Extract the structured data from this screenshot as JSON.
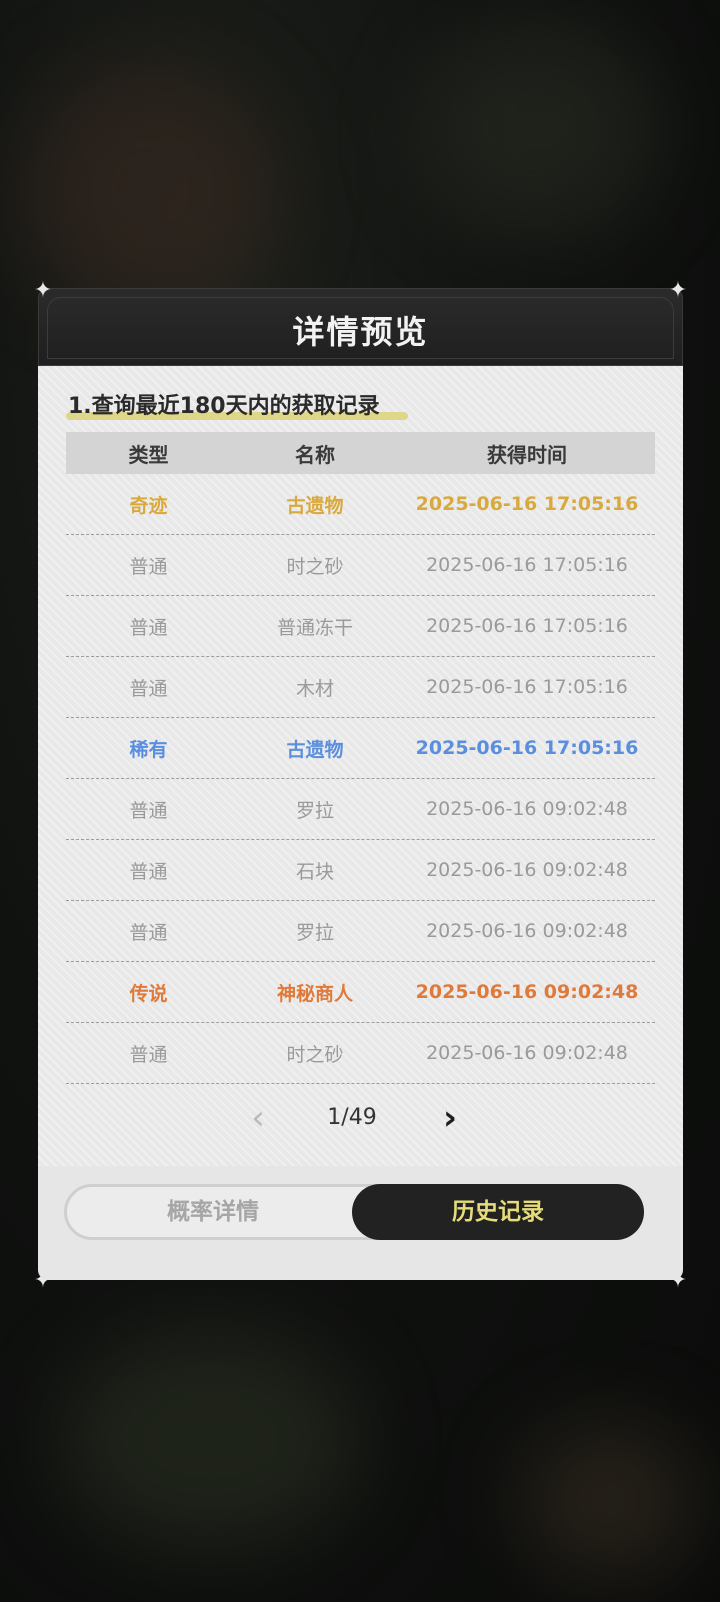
{
  "modal": {
    "title": "详情预览",
    "section_title": "1.查询最近180天内的获取记录",
    "table": {
      "headers": [
        "类型",
        "名称",
        "获得时间"
      ],
      "rows": [
        {
          "type": "奇迹",
          "name": "古遗物",
          "time": "2025-06-16 17:05:16",
          "tier": "wonder"
        },
        {
          "type": "普通",
          "name": "时之砂",
          "time": "2025-06-16 17:05:16",
          "tier": "normal"
        },
        {
          "type": "普通",
          "name": "普通冻干",
          "time": "2025-06-16 17:05:16",
          "tier": "normal"
        },
        {
          "type": "普通",
          "name": "木材",
          "time": "2025-06-16 17:05:16",
          "tier": "normal"
        },
        {
          "type": "稀有",
          "name": "古遗物",
          "time": "2025-06-16 17:05:16",
          "tier": "rare"
        },
        {
          "type": "普通",
          "name": "罗拉",
          "time": "2025-06-16 09:02:48",
          "tier": "normal"
        },
        {
          "type": "普通",
          "name": "石块",
          "time": "2025-06-16 09:02:48",
          "tier": "normal"
        },
        {
          "type": "普通",
          "name": "罗拉",
          "time": "2025-06-16 09:02:48",
          "tier": "normal"
        },
        {
          "type": "传说",
          "name": "神秘商人",
          "time": "2025-06-16 09:02:48",
          "tier": "legend"
        },
        {
          "type": "普通",
          "name": "时之砂",
          "time": "2025-06-16 09:02:48",
          "tier": "normal"
        }
      ]
    },
    "pagination": {
      "page": "1/49",
      "prev_icon": "chevron-left-icon",
      "next_icon": "chevron-right-icon"
    },
    "tabs": [
      {
        "label": "概率详情",
        "active": false
      },
      {
        "label": "历史记录",
        "active": true
      }
    ]
  },
  "colors": {
    "wonder": "#d9a93e",
    "rare": "#5b8fde",
    "legend": "#e07a3b",
    "normal": "#9a9a9a",
    "active_tab_text": "#e6dd7a",
    "underline": "#dcd479"
  }
}
